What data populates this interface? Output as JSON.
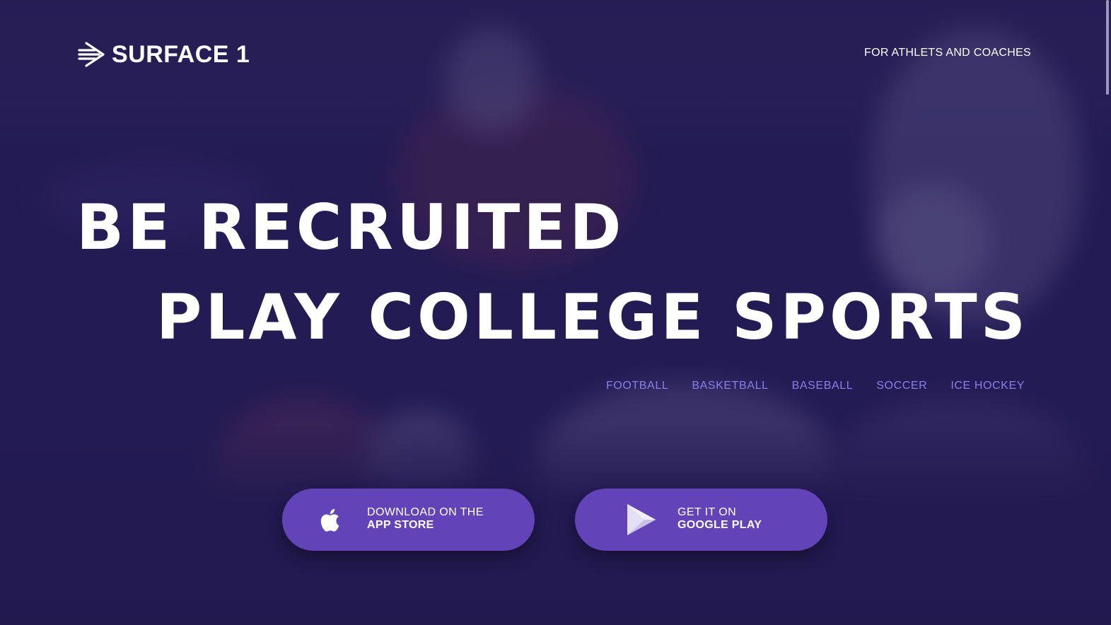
{
  "brand": {
    "logo_text": "SURFACE 1",
    "logo_icon": "surface1-logo-icon"
  },
  "header": {
    "link_label": "FOR ATHLETS AND COACHES"
  },
  "hero": {
    "headline_line1": "BE RECRUITED",
    "headline_line2": "PLAY COLLEGE SPORTS"
  },
  "sports": [
    {
      "label": "FOOTBALL"
    },
    {
      "label": "BASKETBALL"
    },
    {
      "label": "BASEBALL"
    },
    {
      "label": "SOCCER"
    },
    {
      "label": "ICE HOCKEY"
    }
  ],
  "downloads": {
    "app_store": {
      "line1": "DOWNLOAD ON THE",
      "line2": "APP STORE",
      "icon": "apple-icon"
    },
    "google_play": {
      "line1": "GET IT ON",
      "line2": "GOOGLE PLAY",
      "icon": "google-play-icon"
    }
  },
  "colors": {
    "overlay": "#241c58",
    "button": "#6244b8",
    "sport_link": "#8c7ee6",
    "text": "#ffffff"
  }
}
